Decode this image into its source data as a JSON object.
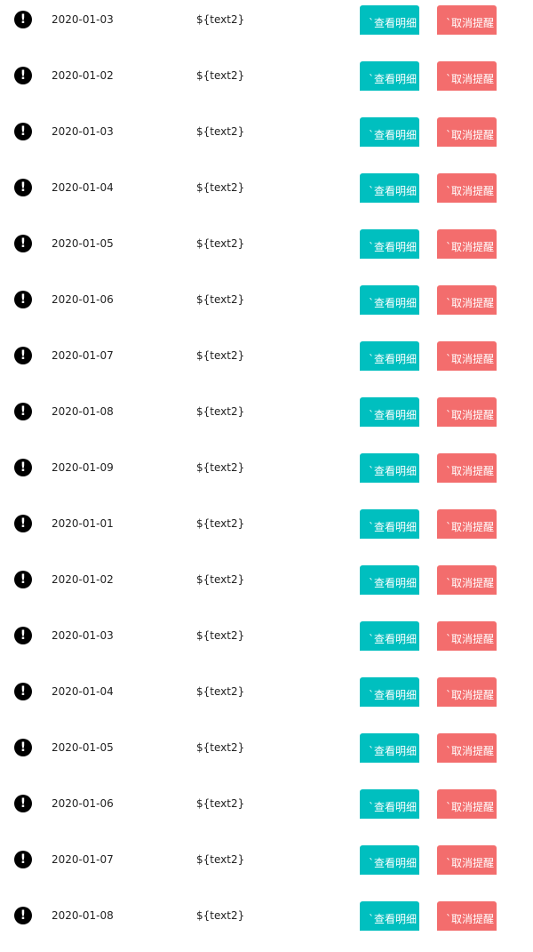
{
  "list": {
    "view_label": "`查看明细",
    "cancel_label": "`取消提醒",
    "alert_glyph": "!",
    "colors": {
      "view_button": "#00bfbf",
      "cancel_button": "#f36d6d",
      "alert_icon": "#000000"
    },
    "rows": [
      {
        "date": "2020-01-03",
        "text": "${text2}"
      },
      {
        "date": "2020-01-02",
        "text": "${text2}"
      },
      {
        "date": "2020-01-03",
        "text": "${text2}"
      },
      {
        "date": "2020-01-04",
        "text": "${text2}"
      },
      {
        "date": "2020-01-05",
        "text": "${text2}"
      },
      {
        "date": "2020-01-06",
        "text": "${text2}"
      },
      {
        "date": "2020-01-07",
        "text": "${text2}"
      },
      {
        "date": "2020-01-08",
        "text": "${text2}"
      },
      {
        "date": "2020-01-09",
        "text": "${text2}"
      },
      {
        "date": "2020-01-01",
        "text": "${text2}"
      },
      {
        "date": "2020-01-02",
        "text": "${text2}"
      },
      {
        "date": "2020-01-03",
        "text": "${text2}"
      },
      {
        "date": "2020-01-04",
        "text": "${text2}"
      },
      {
        "date": "2020-01-05",
        "text": "${text2}"
      },
      {
        "date": "2020-01-06",
        "text": "${text2}"
      },
      {
        "date": "2020-01-07",
        "text": "${text2}"
      },
      {
        "date": "2020-01-08",
        "text": "${text2}"
      }
    ]
  }
}
